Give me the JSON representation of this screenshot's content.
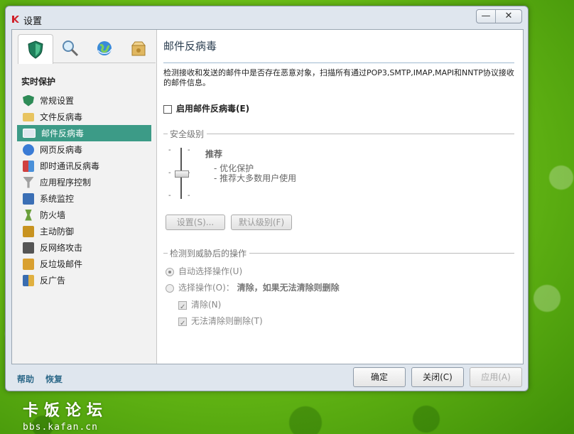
{
  "window": {
    "title": "设置",
    "minimize_glyph": "—",
    "close_glyph": "✕"
  },
  "sidebar": {
    "tabs": [
      {
        "icon": "shield-icon",
        "active": true
      },
      {
        "icon": "magnifier-icon",
        "active": false
      },
      {
        "icon": "globe-icon",
        "active": false
      },
      {
        "icon": "box-icon",
        "active": false
      }
    ],
    "section_title": "实时保护",
    "items": [
      {
        "label": "常规设置",
        "icon": "shield-icon",
        "color": "#2e8b57"
      },
      {
        "label": "文件反病毒",
        "icon": "folder-icon",
        "color": "#e8c460"
      },
      {
        "label": "邮件反病毒",
        "icon": "mail-icon",
        "color": "#dfe8f0",
        "active": true
      },
      {
        "label": "网页反病毒",
        "icon": "globe-icon",
        "color": "#3a7bd5"
      },
      {
        "label": "即时通讯反病毒",
        "icon": "chat-icon",
        "color": "#4a90d9"
      },
      {
        "label": "应用程序控制",
        "icon": "funnel-icon",
        "color": "#a0a0a0"
      },
      {
        "label": "系统监控",
        "icon": "monitor-icon",
        "color": "#3b6fb5"
      },
      {
        "label": "防火墙",
        "icon": "firewall-icon",
        "color": "#6a9f3c"
      },
      {
        "label": "主动防御",
        "icon": "proactive-icon",
        "color": "#c89320"
      },
      {
        "label": "反网络攻击",
        "icon": "network-attack-icon",
        "color": "#555555"
      },
      {
        "label": "反垃圾邮件",
        "icon": "antispam-icon",
        "color": "#d9a030"
      },
      {
        "label": "反广告",
        "icon": "antibanner-icon",
        "color": "#3a6db0"
      }
    ]
  },
  "main": {
    "title": "邮件反病毒",
    "description": "检测接收和发送的邮件中是否存在恶意对象，扫描所有通过POP3,SMTP,IMAP,MAPI和NNTP协议接收的邮件信息。",
    "enable_label": "启用邮件反病毒(E)",
    "security_level": {
      "group_label": "安全级别",
      "level_name": "推荐",
      "level_desc_1": "- 优化保护",
      "level_desc_2": "- 推荐大多数用户使用",
      "settings_button": "设置(S)...",
      "default_button": "默认级别(F)"
    },
    "action": {
      "group_label": "检测到威胁后的操作",
      "auto_label": "自动选择操作(U)",
      "choose_label": "选择操作(O)：",
      "choose_value": "清除，如果无法清除则删除",
      "clean_label": "清除(N)",
      "delete_label": "无法清除则删除(T)"
    }
  },
  "footer": {
    "help": "帮助",
    "restore": "恢复",
    "ok": "确定",
    "close": "关闭(C)",
    "apply": "应用(A)"
  },
  "watermark": {
    "line1": "卡饭论坛",
    "line2": "bbs.kafan.cn"
  }
}
